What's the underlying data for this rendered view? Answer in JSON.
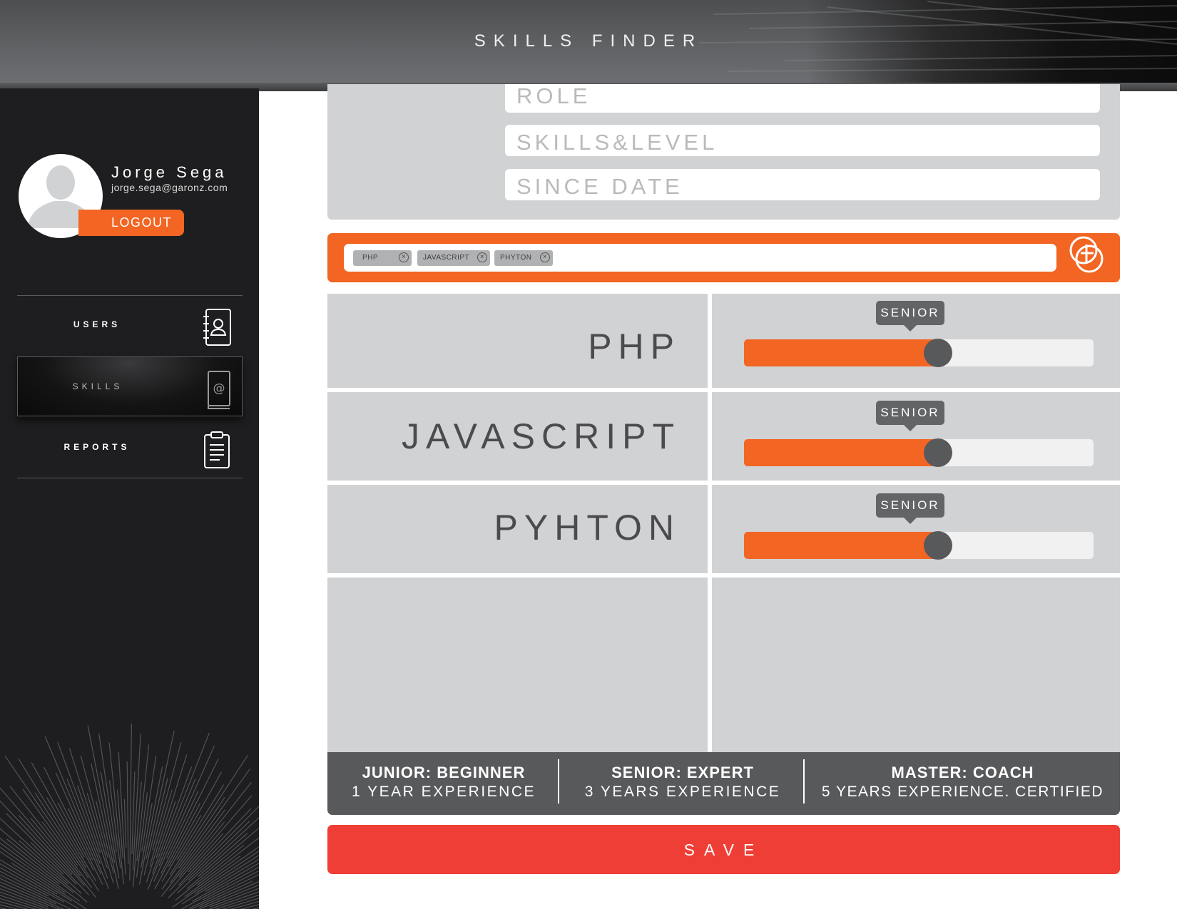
{
  "app": {
    "title": "SKILLS   FINDER"
  },
  "user": {
    "name": "Jorge Sega",
    "email": "jorge.sega@garonz.com",
    "logout_label": "LOGOUT"
  },
  "nav": {
    "items": [
      {
        "label": "USERS",
        "icon": "contacts-book-icon",
        "active": false
      },
      {
        "label": "SKILLS",
        "icon": "address-book-icon",
        "active": true
      },
      {
        "label": "REPORTS",
        "icon": "clipboard-icon",
        "active": false
      }
    ]
  },
  "form": {
    "role_placeholder": "ROLE",
    "skills_placeholder": "SKILLS&LEVEL",
    "since_placeholder": "SINCE DATE"
  },
  "tags": [
    "PHP",
    "JAVASCRIPT",
    "PHYTON"
  ],
  "skills": [
    {
      "name": "PHP",
      "level": "SENIOR",
      "progress": 0.555
    },
    {
      "name": "JAVASCRIPT",
      "level": "SENIOR",
      "progress": 0.555
    },
    {
      "name": "PYHTON",
      "level": "SENIOR",
      "progress": 0.555
    }
  ],
  "legend": [
    {
      "title": "JUNIOR: BEGINNER",
      "subtitle": "1 YEAR EXPERIENCE"
    },
    {
      "title": "SENIOR: EXPERT",
      "subtitle": "3 YEARS EXPERIENCE"
    },
    {
      "title": "MASTER: COACH",
      "subtitle": "5 YEARS EXPERIENCE. CERTIFIED"
    }
  ],
  "save_label": "SAVE",
  "colors": {
    "accent": "#f26522",
    "save": "#ef3e35",
    "panel": "#d1d2d4",
    "sidebar": "#1e1e20"
  }
}
